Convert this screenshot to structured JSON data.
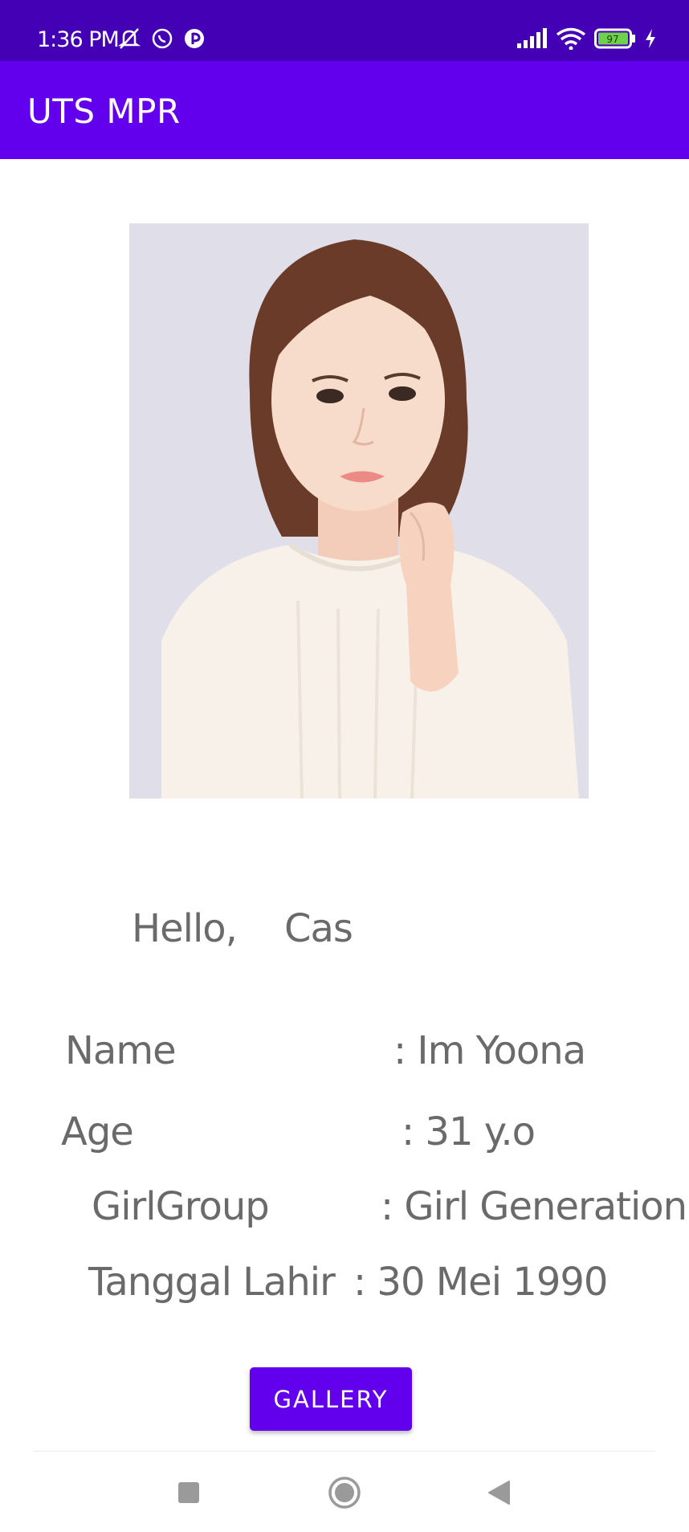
{
  "status_bar": {
    "time": "1:36 PM",
    "battery": "97",
    "icons": [
      "mute-icon",
      "whatsapp-icon",
      "app-icon",
      "signal-icon",
      "wifi-icon",
      "battery-icon",
      "charging-icon"
    ]
  },
  "app_bar": {
    "title": "UTS MPR"
  },
  "profile": {
    "greeting": "Hello,",
    "user": "Cas",
    "rows": [
      {
        "label": "Name",
        "value": ": Im Yoona"
      },
      {
        "label": "Age",
        "value": ": 31 y.o"
      },
      {
        "label": "GirlGroup",
        "value": ": Girl Generation"
      },
      {
        "label": "Tanggal Lahir",
        "value": ": 30 Mei 1990"
      }
    ]
  },
  "gallery_button": {
    "label": "GALLERY"
  },
  "colors": {
    "status_bar": "#4300b5",
    "primary": "#6200ee",
    "text": "#6a6a6a"
  },
  "nav": {
    "icons": [
      "recent-apps-icon",
      "home-icon",
      "back-icon"
    ]
  }
}
